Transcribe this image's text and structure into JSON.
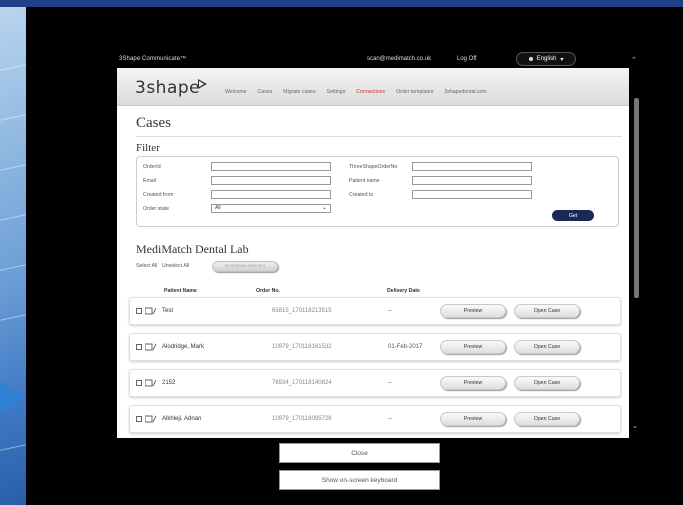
{
  "app": {
    "name": "3Shape Communicate™",
    "user_email": "scan@medimatch.co.uk",
    "logoff": "Log Off",
    "language": "English"
  },
  "nav": {
    "logo": "3shape",
    "links": [
      "Welcome",
      "Cases",
      "Migrate cases",
      "Settings",
      "Connections",
      "Order templates",
      "3shapedental.com"
    ],
    "active_link": "Connections"
  },
  "page": {
    "title": "Cases",
    "filter_title": "Filter"
  },
  "filter": {
    "order_id_label": "OrderId",
    "email_label": "Email",
    "created_from_label": "Created from",
    "order_state_label": "Order state",
    "order_state_value": "All",
    "tso_label": "ThreeShapeOrderNo",
    "patient_name_label": "Patient name",
    "created_to_label": "Created to",
    "get_label": "Get"
  },
  "lab": {
    "title": "MediMatch Dental Lab",
    "select_all": "Select All",
    "unselect_all": "Unselect All",
    "download_label": "Download selected"
  },
  "table": {
    "headers": [
      "Patient Name",
      "Order No.",
      "Delivery Date"
    ],
    "preview_label": "Preview",
    "open_label": "Open Case",
    "rows": [
      {
        "name": "Test",
        "order": "65815_170118213515",
        "date": "--"
      },
      {
        "name": "Alodridge, Mark",
        "order": "10979_170118161532",
        "date": "01-Feb-2017"
      },
      {
        "name": "2152",
        "order": "76934_170118140824",
        "date": "--"
      },
      {
        "name": "Alkhleji, Adnan",
        "order": "10979_170118095726",
        "date": "--"
      }
    ]
  },
  "bottom": {
    "close_label": "Close",
    "keyboard_label": "Show on-screen keyboard"
  },
  "colors": {
    "top_band": "#1f3f86",
    "get_button": "#1b2a55",
    "active_nav": "#c0392b"
  }
}
